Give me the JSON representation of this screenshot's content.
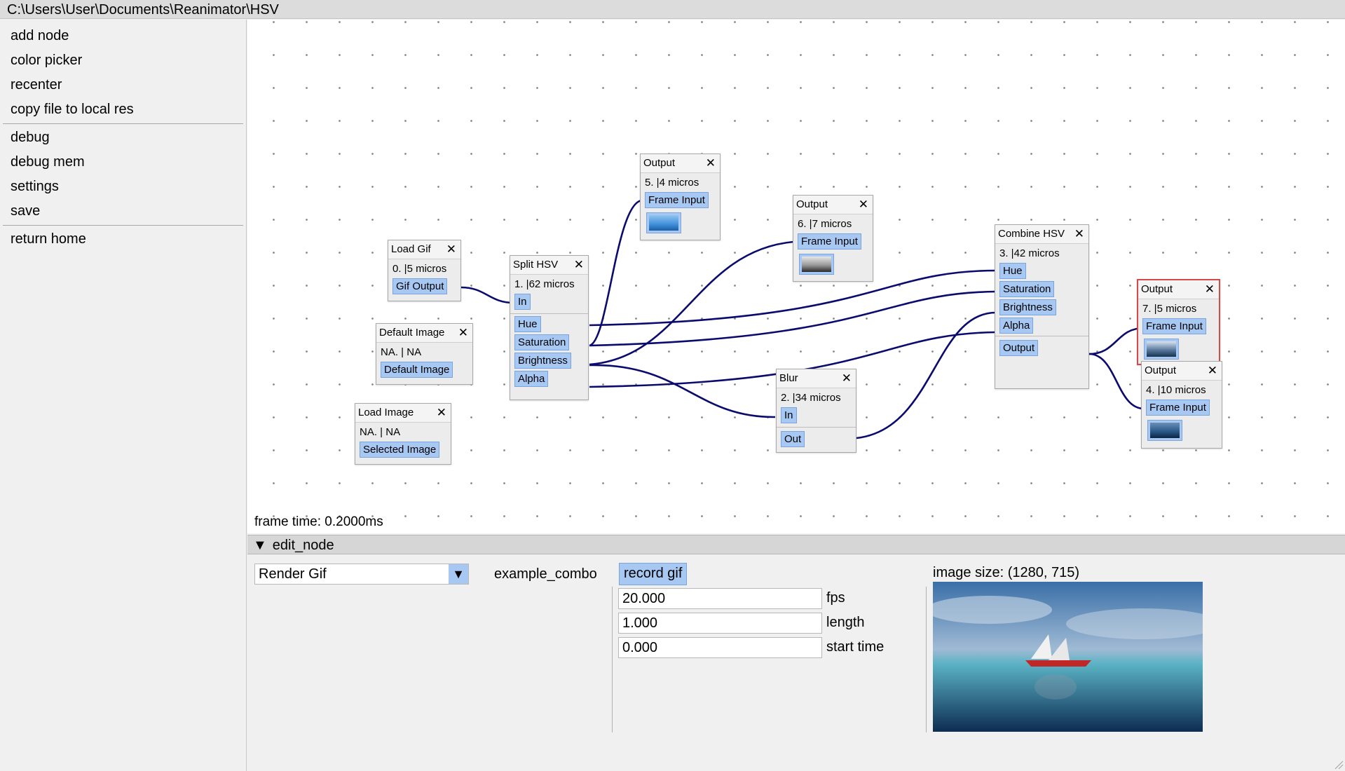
{
  "title": "C:\\Users\\User\\Documents\\Reanimator\\HSV",
  "menu": {
    "group1": [
      "add node",
      "color picker",
      "recenter",
      "copy file to local res"
    ],
    "group2": [
      "debug",
      "debug mem",
      "settings",
      "save"
    ],
    "group3": [
      "return home"
    ]
  },
  "close_glyph": "✕",
  "nodes": {
    "load_gif": {
      "title": "Load Gif",
      "time": "0. |5 micros",
      "pin": "Gif Output"
    },
    "default_image": {
      "title": "Default Image",
      "time": "NA. | NA",
      "pin": "Default Image"
    },
    "load_image": {
      "title": "Load Image",
      "time": "NA. | NA",
      "pin": "Selected Image"
    },
    "split_hsv": {
      "title": "Split HSV",
      "time": "1. |62 micros",
      "input": "In",
      "outputs": [
        "Hue",
        "Saturation",
        "Brightness",
        "Alpha"
      ]
    },
    "output5": {
      "title": "Output",
      "time": "5. |4 micros",
      "pin": "Frame Input"
    },
    "output6": {
      "title": "Output",
      "time": "6. |7 micros",
      "pin": "Frame Input"
    },
    "combine_hsv": {
      "title": "Combine HSV",
      "time": "3. |42 micros",
      "inputs": [
        "Hue",
        "Saturation",
        "Brightness",
        "Alpha"
      ],
      "output": "Output"
    },
    "blur": {
      "title": "Blur",
      "time": "2. |34 micros",
      "input": "In",
      "output": "Out"
    },
    "output7": {
      "title": "Output",
      "time": "7. |5 micros",
      "pin": "Frame Input"
    },
    "output4": {
      "title": "Output",
      "time": "4. |10 micros",
      "pin": "Frame Input"
    }
  },
  "frame_time": "frame time: 0.2000ms",
  "edit_node": {
    "header": "edit_node",
    "combo_value": "Render Gif",
    "combo_label": "example_combo",
    "record_label": "record gif",
    "fps_value": "20.000",
    "fps_label": "fps",
    "length_value": "1.000",
    "length_label": "length",
    "start_value": "0.000",
    "start_label": "start time",
    "image_size": "image size: (1280, 715)"
  },
  "colors": {
    "wire": "#0b0b6e",
    "pin": "#a8c8f4",
    "selected_border": "#d44a4a"
  }
}
